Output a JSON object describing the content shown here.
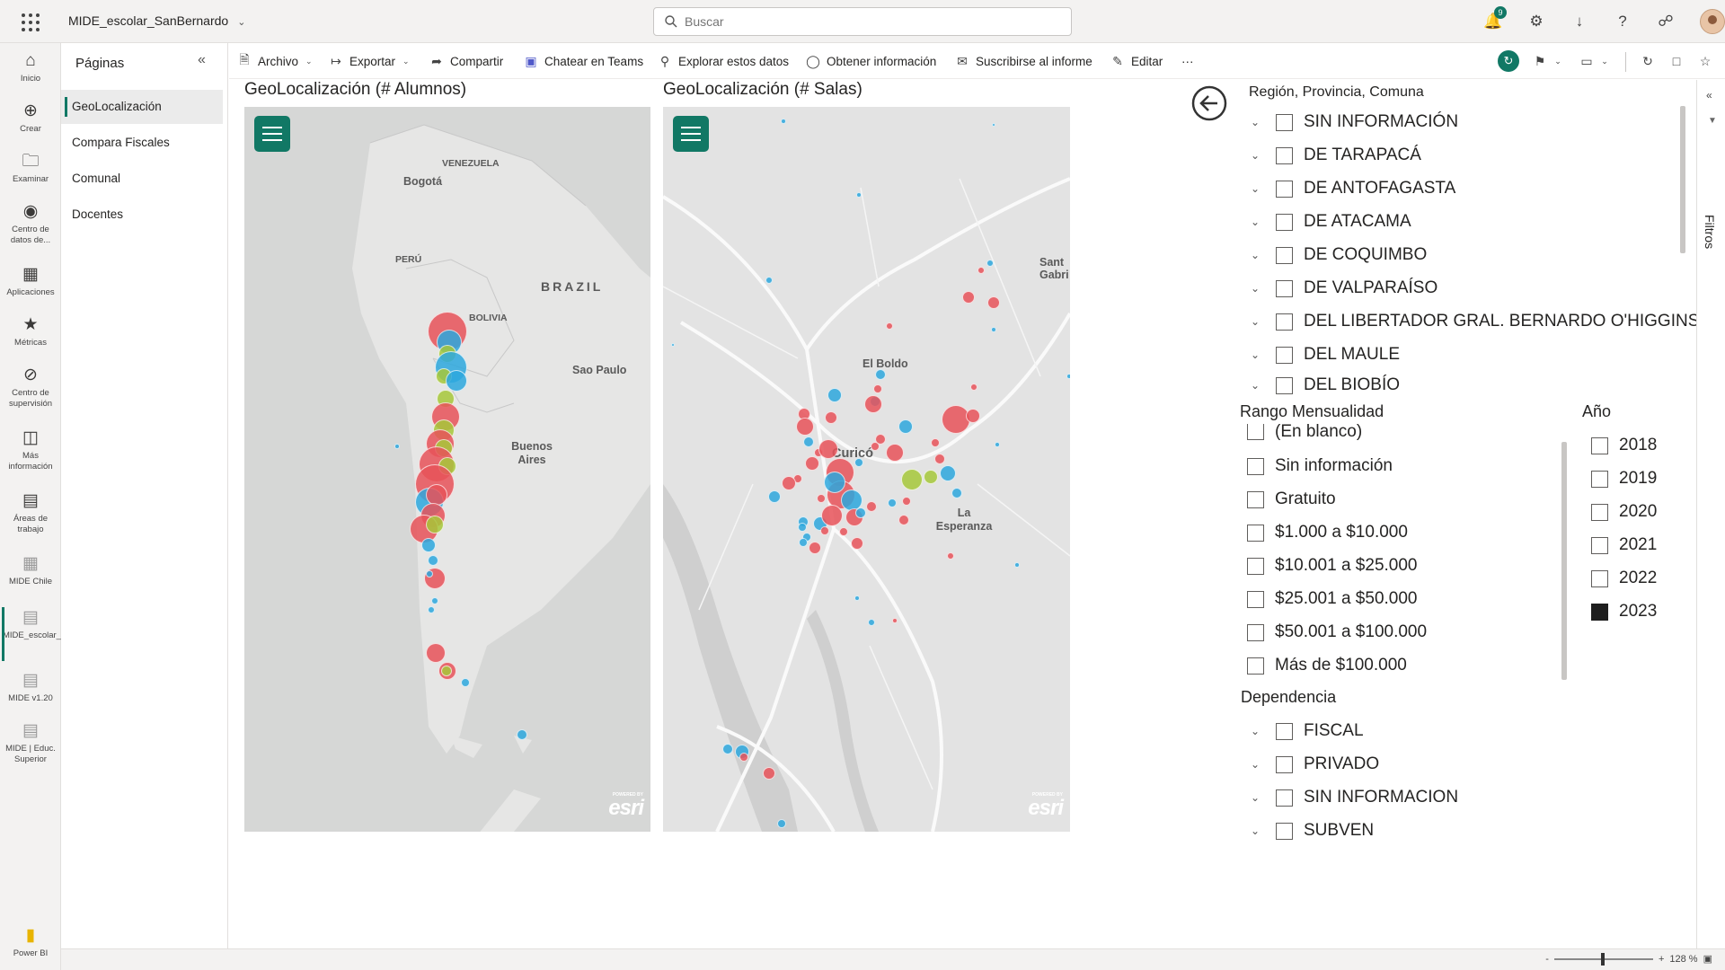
{
  "header": {
    "app_name": "MIDE_escolar_SanBernardo",
    "search_placeholder": "Buscar",
    "notifications_count": "9"
  },
  "rail": [
    {
      "label": "Inicio",
      "icon": "home-icon"
    },
    {
      "label": "Crear",
      "icon": "plus-icon"
    },
    {
      "label": "Examinar",
      "icon": "folder-icon"
    },
    {
      "label": "Centro de datos de...",
      "icon": "data-hub-icon"
    },
    {
      "label": "Aplicaciones",
      "icon": "apps-icon"
    },
    {
      "label": "Métricas",
      "icon": "trophy-icon"
    },
    {
      "label": "Centro de supervisión",
      "icon": "monitor-icon"
    },
    {
      "label": "Más información",
      "icon": "book-icon"
    },
    {
      "label": "Áreas de trabajo",
      "icon": "workspaces-icon"
    },
    {
      "label": "MIDE Chile",
      "icon": "workspace-icon"
    },
    {
      "label": "MIDE_escolar_SanBer...",
      "icon": "report-icon"
    },
    {
      "label": "MIDE v1.20",
      "icon": "report-icon"
    },
    {
      "label": "MIDE | Educ. Superior",
      "icon": "report-icon"
    },
    {
      "label": "Power BI",
      "icon": "powerbi-icon"
    }
  ],
  "pages_pane": {
    "title": "Páginas",
    "items": [
      "GeoLocalización",
      "Compara Fiscales",
      "Comunal",
      "Docentes"
    ],
    "active": "GeoLocalización"
  },
  "toolbar": {
    "archivo": "Archivo",
    "exportar": "Exportar",
    "compartir": "Compartir",
    "chatear": "Chatear en Teams",
    "explorar": "Explorar estos datos",
    "obtener": "Obtener información",
    "suscribirse": "Suscribirse al informe",
    "editar": "Editar",
    "more": "···"
  },
  "maps": {
    "alumnos": {
      "title": "GeoLocalización (# Alumnos)",
      "labels": {
        "bogota": "Bogotá",
        "venezuela": "VENEZUELA",
        "peru": "PERÚ",
        "brazil": "BRAZIL",
        "bolivia": "BOLIVIA",
        "sao_paulo": "Sao Paulo",
        "buenos_aires": "Buenos Aires"
      }
    },
    "salas": {
      "title": "GeoLocalización (# Salas)",
      "labels": {
        "el_boldo": "El Boldo",
        "curico": "Curicó",
        "la_esperanza": "La Esperanza",
        "santa_gabriela": "Sant Gabri"
      }
    },
    "esri": "esri",
    "esri_powered": "POWERED BY",
    "colors": {
      "red": "#e8535a",
      "blue": "#2da8de",
      "green": "#a7c83a"
    }
  },
  "slicers": {
    "region": {
      "title": "Región, Provincia, Comuna",
      "items": [
        "SIN INFORMACIÓN",
        "DE TARAPACÁ",
        "DE ANTOFAGASTA",
        "DE ATACAMA",
        "DE COQUIMBO",
        "DE VALPARAÍSO",
        "DEL LIBERTADOR GRAL. BERNARDO O'HIGGINS",
        "DEL MAULE",
        "DEL BIOBÍO"
      ]
    },
    "rango": {
      "title": "Rango Mensualidad",
      "items": [
        "(En blanco)",
        "Sin información",
        "Gratuito",
        "$1.000 a $10.000",
        "$10.001 a $25.000",
        "$25.001 a $50.000",
        "$50.001 a $100.000",
        "Más de $100.000"
      ]
    },
    "anio": {
      "title": "Año",
      "items": [
        "2018",
        "2019",
        "2020",
        "2021",
        "2022",
        "2023"
      ],
      "selected": "2023"
    },
    "dependencia": {
      "title": "Dependencia",
      "items": [
        "FISCAL",
        "PRIVADO",
        "SIN INFORMACION",
        "SUBVEN"
      ]
    }
  },
  "filters_pane": {
    "label": "Filtros"
  },
  "footer": {
    "zoom": "128 %",
    "minus": "-",
    "plus": "+"
  }
}
